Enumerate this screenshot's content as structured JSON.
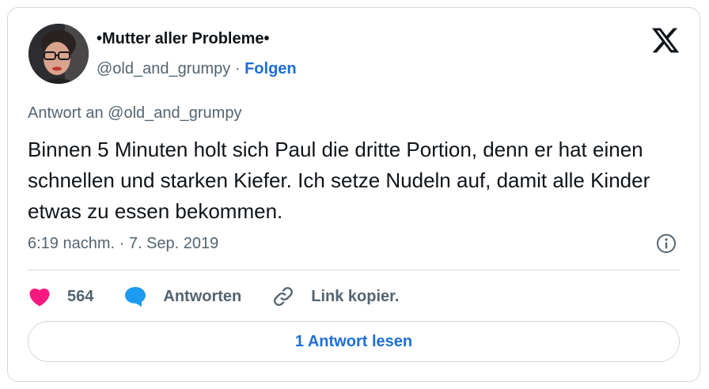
{
  "author": {
    "display_name": "•Mutter aller Probleme•",
    "handle": "@old_and_grumpy",
    "separator": "·",
    "follow_label": "Folgen"
  },
  "logo": {
    "icon": "x-logo-icon"
  },
  "tweet": {
    "reply_to": "Antwort an @old_and_grumpy",
    "text": "Binnen 5 Minuten holt sich Paul die dritte Portion, denn er hat einen schnellen und starken Kiefer. Ich setze Nudeln auf, damit alle Kinder etwas zu essen bekommen.",
    "timestamp": "6:19 nachm. · 7. Sep. 2019"
  },
  "actions": {
    "like_count": "564",
    "reply_label": "Antworten",
    "copy_link_label": "Link kopier."
  },
  "read_replies_label": "1 Antwort lesen",
  "colors": {
    "heart": "#f91880",
    "bubble": "#1d9bf0",
    "link_blue": "#1d6fd6",
    "muted": "#536471",
    "border": "#cfd9de"
  }
}
